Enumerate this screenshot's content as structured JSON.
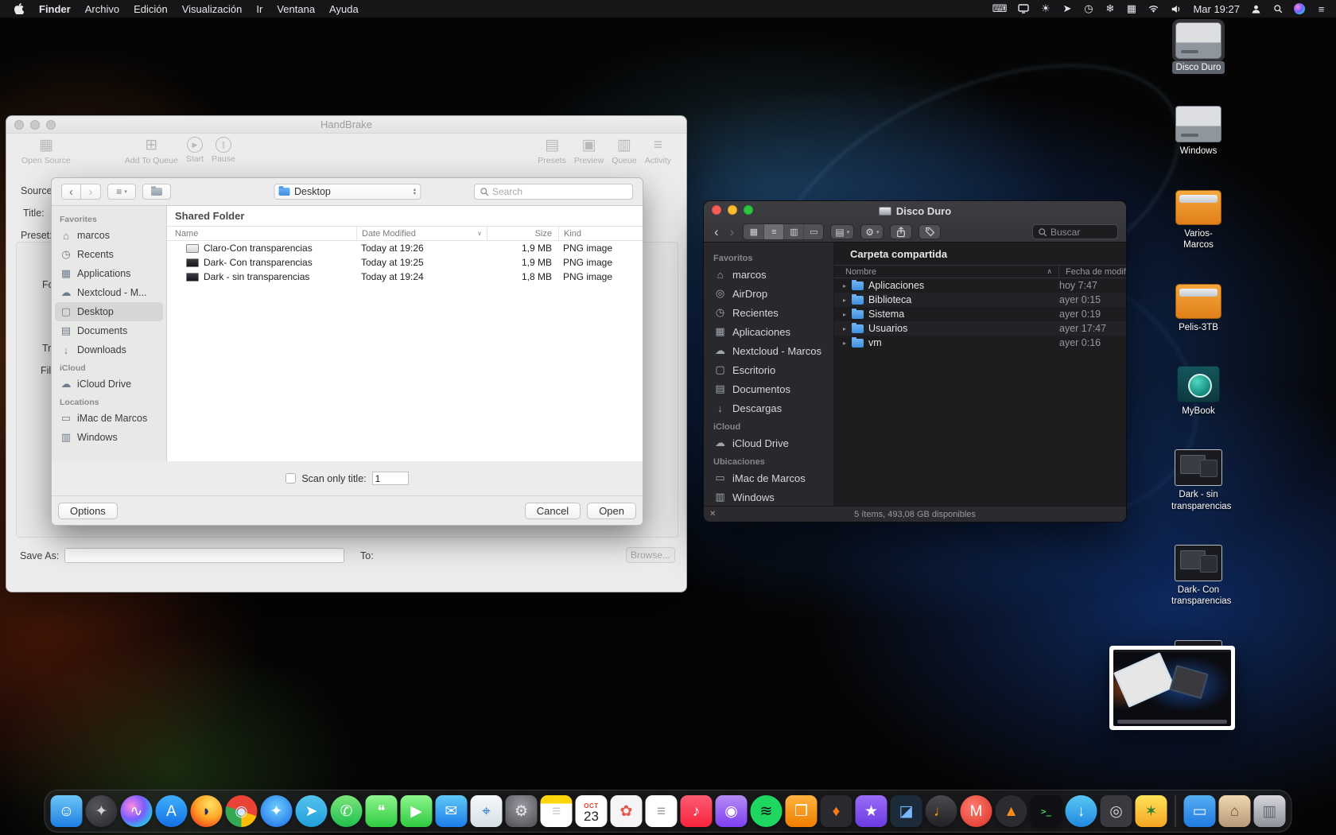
{
  "menu_bar": {
    "menus": [
      "Finder",
      "Archivo",
      "Edición",
      "Visualización",
      "Ir",
      "Ventana",
      "Ayuda"
    ],
    "status_icons": [
      "input-source",
      "display",
      "brightness",
      "pointer",
      "time-machine",
      "fan",
      "keyboard",
      "wifi",
      "volume"
    ],
    "clock": "Mar 19:27",
    "right_icons": [
      "user",
      "spotlight",
      "siri",
      "control-list"
    ]
  },
  "handbrake": {
    "window_title": "HandBrake",
    "toolbar_left": [
      {
        "icon": "film",
        "label": "Open Source"
      },
      {
        "icon": "add-queue",
        "label": "Add To Queue"
      },
      {
        "icon": "play",
        "label": "Start"
      },
      {
        "icon": "pause",
        "label": "Pause"
      }
    ],
    "toolbar_right": [
      {
        "icon": "presets",
        "label": "Presets"
      },
      {
        "icon": "preview",
        "label": "Preview"
      },
      {
        "icon": "queue",
        "label": "Queue"
      },
      {
        "icon": "activity",
        "label": "Activity"
      }
    ],
    "field_labels": {
      "source": "Source:",
      "title": "Title:",
      "preset": "Preset:"
    },
    "fragments": [
      "For",
      "Tra",
      "Fil"
    ],
    "save_as_label": "Save As:",
    "to_label": "To:",
    "browse_button": "Browse...",
    "open_dialog": {
      "location": "Desktop",
      "search_placeholder": "Search",
      "sidebar": [
        {
          "title": "Favorites",
          "items": [
            {
              "icon": "home",
              "label": "marcos"
            },
            {
              "icon": "clock",
              "label": "Recents"
            },
            {
              "icon": "apps",
              "label": "Applications"
            },
            {
              "icon": "cloud-folder",
              "label": "Nextcloud - M..."
            },
            {
              "icon": "desktop",
              "label": "Desktop",
              "selected": true
            },
            {
              "icon": "documents",
              "label": "Documents"
            },
            {
              "icon": "downloads",
              "label": "Downloads"
            }
          ]
        },
        {
          "title": "iCloud",
          "items": [
            {
              "icon": "cloud",
              "label": "iCloud Drive"
            }
          ]
        },
        {
          "title": "Locations",
          "items": [
            {
              "icon": "imac",
              "label": "iMac de Marcos"
            },
            {
              "icon": "drive",
              "label": "Windows"
            }
          ]
        }
      ],
      "folder_header": "Shared Folder",
      "columns": [
        "Name",
        "Date Modified",
        "Size",
        "Kind"
      ],
      "rows": [
        {
          "thumb": "light",
          "name": "Claro-Con transparencias",
          "date": "Today at 19:26",
          "size": "1,9 MB",
          "kind": "PNG image"
        },
        {
          "thumb": "dark",
          "name": "Dark- Con transparencias",
          "date": "Today at 19:25",
          "size": "1,9 MB",
          "kind": "PNG image"
        },
        {
          "thumb": "dark",
          "name": "Dark - sin transparencias",
          "date": "Today at 19:24",
          "size": "1,8 MB",
          "kind": "PNG image"
        }
      ],
      "scan_label": "Scan only title:",
      "scan_value": "1",
      "options_button": "Options",
      "cancel_button": "Cancel",
      "open_button": "Open"
    }
  },
  "finder": {
    "window_title": "Disco Duro",
    "search_placeholder": "Buscar",
    "sidebar": [
      {
        "title": "Favoritos",
        "items": [
          {
            "icon": "home",
            "label": "marcos"
          },
          {
            "icon": "airdrop",
            "label": "AirDrop"
          },
          {
            "icon": "clock",
            "label": "Recientes"
          },
          {
            "icon": "apps",
            "label": "Aplicaciones"
          },
          {
            "icon": "cloud-folder",
            "label": "Nextcloud - Marcos"
          },
          {
            "icon": "desktop",
            "label": "Escritorio"
          },
          {
            "icon": "documents",
            "label": "Documentos"
          },
          {
            "icon": "downloads",
            "label": "Descargas"
          }
        ]
      },
      {
        "title": "iCloud",
        "items": [
          {
            "icon": "cloud",
            "label": "iCloud Drive"
          }
        ]
      },
      {
        "title": "Ubicaciones",
        "items": [
          {
            "icon": "imac",
            "label": "iMac de Marcos"
          },
          {
            "icon": "drive",
            "label": "Windows"
          }
        ]
      }
    ],
    "folder_header": "Carpeta compartida",
    "columns": {
      "name": "Nombre",
      "date": "Fecha de modif"
    },
    "rows": [
      {
        "name": "Aplicaciones",
        "date": "hoy 7:47"
      },
      {
        "name": "Biblioteca",
        "date": "ayer 0:15"
      },
      {
        "name": "Sistema",
        "date": "ayer 0:19"
      },
      {
        "name": "Usuarios",
        "date": "ayer 17:47"
      },
      {
        "name": "vm",
        "date": "ayer 0:16"
      }
    ],
    "status": "5 ítems, 493,08 GB disponibles"
  },
  "desktop_icons": [
    {
      "type": "internal-drive",
      "label": "Disco Duro",
      "selected": true
    },
    {
      "type": "internal-drive",
      "label": "Windows"
    },
    {
      "type": "external-drive",
      "label": "Varios-Marcos"
    },
    {
      "type": "external-drive",
      "label": "Pelis-3TB"
    },
    {
      "type": "timemachine-drive",
      "label": "MyBook"
    },
    {
      "type": "image-file",
      "label": "Dark - sin transparencias"
    },
    {
      "type": "image-file",
      "label": "Dark- Con transparencias"
    },
    {
      "type": "image-file",
      "label": ""
    }
  ],
  "dock": {
    "items": [
      {
        "name": "finder",
        "glyph": "☺",
        "bg": "linear-gradient(180deg,#6ec6f7,#1d7fe3)",
        "shape": "square",
        "fg": "#ffffff"
      },
      {
        "name": "launchpad",
        "glyph": "✦",
        "bg": "radial-gradient(circle at 35% 35%,#55555c,#242428)",
        "shape": "circle",
        "fg": "#cfd2d8"
      },
      {
        "name": "siri",
        "glyph": "∿",
        "bg": "radial-gradient(circle at 35% 35%,#ff8ae0,#7a5cff 45%,#24c8e8 78%,#121224)",
        "shape": "circle",
        "fg": "#ffffff"
      },
      {
        "name": "app-store",
        "glyph": "A",
        "bg": "linear-gradient(180deg,#3fb0fc,#1470e6)",
        "shape": "circle",
        "fg": "#ffffff"
      },
      {
        "name": "firefox",
        "glyph": "◗",
        "bg": "radial-gradient(circle at 62% 30%,#ffe066,#ffa726 45%,#f4511e 78%,#c43c18)",
        "shape": "circle",
        "fg": "#2b2b66"
      },
      {
        "name": "chrome",
        "glyph": "◉",
        "bg": "conic-gradient(#ea4335 0 30%,#fbbc05 30% 50%,#34a853 50% 80%,#ea4335 80%)",
        "shape": "circle",
        "fg": "#d6e6ff"
      },
      {
        "name": "safari",
        "glyph": "✦",
        "bg": "radial-gradient(circle at 50% 40%,#6fd0ff,#1668e3)",
        "shape": "circle",
        "fg": "#ffffff"
      },
      {
        "name": "telegram",
        "glyph": "➤",
        "bg": "linear-gradient(180deg,#54c3ef,#229ed9)",
        "shape": "circle",
        "fg": "#ffffff"
      },
      {
        "name": "whatsapp",
        "glyph": "✆",
        "bg": "linear-gradient(180deg,#7ae57a,#1fbf4e)",
        "shape": "circle",
        "fg": "#ffffff"
      },
      {
        "name": "messages",
        "glyph": "❝",
        "bg": "linear-gradient(180deg,#8df58d,#2ecc41)",
        "shape": "square",
        "fg": "#ffffff"
      },
      {
        "name": "facetime",
        "glyph": "▶",
        "bg": "linear-gradient(180deg,#8df58d,#2fca40)",
        "shape": "square",
        "fg": "#ffffff"
      },
      {
        "name": "mail",
        "glyph": "✉",
        "bg": "linear-gradient(180deg,#5fc9f8,#1c7ce8)",
        "shape": "square",
        "fg": "#ffffff"
      },
      {
        "name": "maps",
        "glyph": "⌖",
        "bg": "linear-gradient(180deg,#f6f9fb,#d7e0e6)",
        "shape": "square",
        "fg": "#2a7de1"
      },
      {
        "name": "system-preferences",
        "glyph": "⚙",
        "bg": "radial-gradient(circle at 50% 35%,#9a9aa2,#4c4c52)",
        "shape": "square",
        "fg": "#e8e8ec"
      },
      {
        "name": "notes",
        "glyph": "≡",
        "bg": "linear-gradient(180deg,#ffd60a 0 26%,#ffffff 26%)",
        "shape": "square",
        "fg": "#c9c9c9"
      },
      {
        "name": "calendar",
        "special": "calendar",
        "month": "OCT",
        "day": "23",
        "bg": "#ffffff",
        "shape": "square"
      },
      {
        "name": "photos",
        "glyph": "✿",
        "bg": "#f5f5f7",
        "shape": "square",
        "fg": "#e8554d"
      },
      {
        "name": "reminders",
        "glyph": "≡",
        "bg": "#ffffff",
        "shape": "square",
        "fg": "#9a9a9f"
      },
      {
        "name": "music",
        "glyph": "♪",
        "bg": "linear-gradient(180deg,#fb5c74,#fa233b)",
        "shape": "square",
        "fg": "#ffffff"
      },
      {
        "name": "podcasts",
        "glyph": "◉",
        "bg": "linear-gradient(180deg,#b48cf2,#7e3ff2)",
        "shape": "square",
        "fg": "#ffffff"
      },
      {
        "name": "spotify",
        "glyph": "≋",
        "bg": "#1ed760",
        "shape": "circle",
        "fg": "#0b0b0b"
      },
      {
        "name": "books",
        "glyph": "❒",
        "bg": "linear-gradient(180deg,#ffb340,#f07d00)",
        "shape": "square",
        "fg": "#ffffff"
      },
      {
        "name": "flame-app",
        "glyph": "♦",
        "bg": "#2a2a2e",
        "shape": "square",
        "fg": "#ff7a18"
      },
      {
        "name": "star-app",
        "glyph": "★",
        "bg": "linear-gradient(180deg,#9a6cf8,#6a3be0)",
        "shape": "square",
        "fg": "#ffffff"
      },
      {
        "name": "photo-editor",
        "glyph": "◪",
        "bg": "#1c2b3a",
        "shape": "square",
        "fg": "#7ab8ff"
      },
      {
        "name": "garageband",
        "glyph": "♩",
        "bg": "linear-gradient(180deg,#4a4a50,#202024)",
        "shape": "circle",
        "fg": "#ff9500"
      },
      {
        "name": "gmail",
        "glyph": "M",
        "bg": "radial-gradient(circle at 40% 35%,#ff7b6e,#d93025)",
        "shape": "circle",
        "fg": "#ffffff"
      },
      {
        "name": "media-player",
        "glyph": "▲",
        "bg": "#2c2c30",
        "shape": "circle",
        "fg": "#ff8c1a"
      },
      {
        "name": "terminal",
        "glyph": ">_",
        "small": true,
        "bg": "#101014",
        "shape": "square",
        "fg": "#3fde55"
      },
      {
        "name": "download-manager",
        "glyph": "↓",
        "bg": "linear-gradient(180deg,#58c7f5,#2188e0)",
        "shape": "circle",
        "fg": "#ffffff"
      },
      {
        "name": "camera-app",
        "glyph": "◎",
        "bg": "#39393f",
        "shape": "square",
        "fg": "#cfd2d8"
      },
      {
        "name": "pineapple-app",
        "glyph": "✶",
        "bg": "linear-gradient(180deg,#ffe259,#f5a623)",
        "shape": "square",
        "fg": "#2e7d32"
      },
      {
        "divider": true
      },
      {
        "name": "shared-screen",
        "glyph": "▭",
        "bg": "linear-gradient(180deg,#56aef2,#1f7ae0)",
        "shape": "square",
        "fg": "#eaf4ff"
      },
      {
        "name": "home-folder",
        "glyph": "⌂",
        "bg": "linear-gradient(180deg,#efd9ae,#b7987a)",
        "shape": "square",
        "fg": "#6b4f3a"
      },
      {
        "name": "trash",
        "glyph": "▥",
        "bg": "linear-gradient(180deg,rgba(225,226,232,.95),rgba(150,152,160,.95))",
        "shape": "square",
        "fg": "#65676e"
      }
    ]
  }
}
